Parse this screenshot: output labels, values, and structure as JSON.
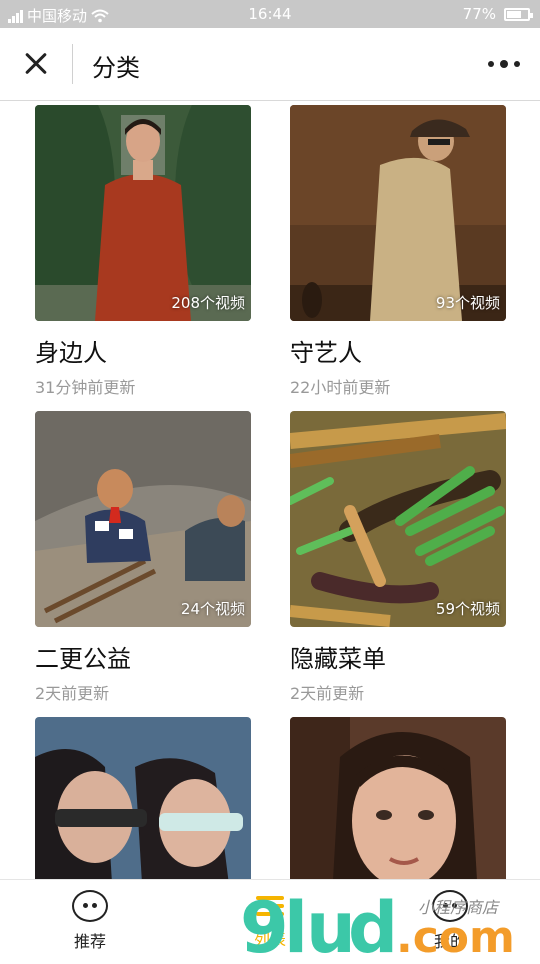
{
  "status_bar": {
    "carrier": "中国移动",
    "time": "16:44",
    "battery": "77%",
    "battery_level": 0.77
  },
  "header": {
    "title": "分类"
  },
  "categories": [
    {
      "title": "身边人",
      "updated": "31分钟前更新",
      "count": "208个视频"
    },
    {
      "title": "守艺人",
      "updated": "22小时前更新",
      "count": "93个视频"
    },
    {
      "title": "二更公益",
      "updated": "2天前更新",
      "count": "24个视频"
    },
    {
      "title": "隐藏菜单",
      "updated": "2天前更新",
      "count": "59个视频"
    },
    {
      "title": "",
      "updated": "",
      "count": ""
    },
    {
      "title": "",
      "updated": "",
      "count": ""
    }
  ],
  "tabbar": {
    "items": [
      {
        "label": "推荐",
        "icon": "smiley-icon"
      },
      {
        "label": "列表",
        "icon": "list-icon"
      },
      {
        "label": "我的",
        "icon": "smiley-icon"
      }
    ]
  },
  "watermark": {
    "logo_text": "9lud.com",
    "cursive_text": "小程序商店"
  }
}
